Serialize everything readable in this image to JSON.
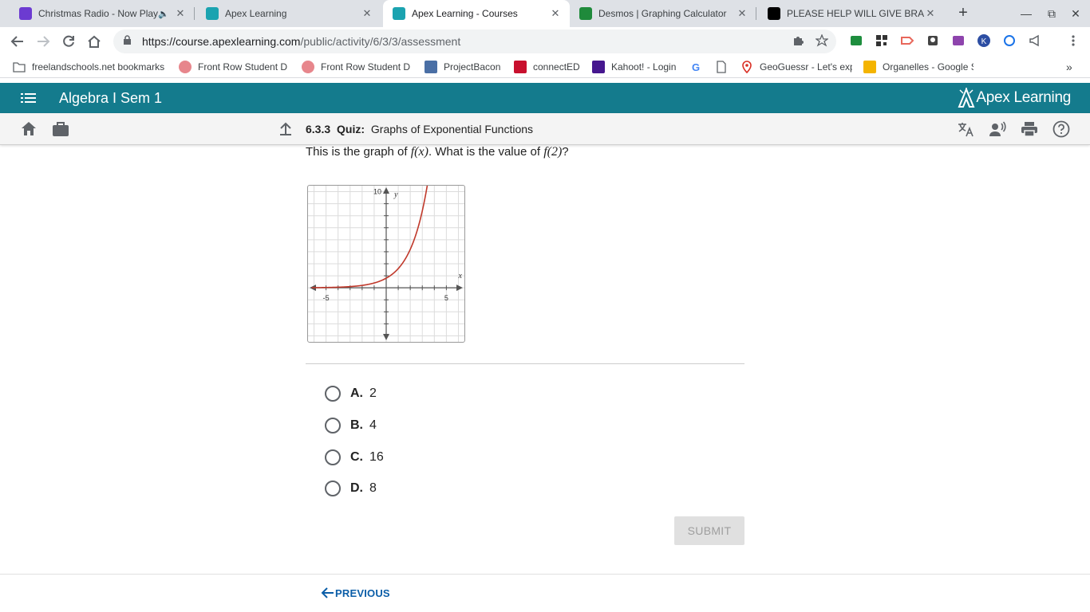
{
  "browser": {
    "tabs": [
      {
        "title": "Christmas Radio - Now Playing",
        "favicon_color": "#6c3bd1"
      },
      {
        "title": "Apex Learning",
        "favicon_color": "#1ba3b0"
      },
      {
        "title": "Apex Learning - Courses",
        "favicon_color": "#1ba3b0"
      },
      {
        "title": "Desmos | Graphing Calculator",
        "favicon_color": "#1f8a3b"
      },
      {
        "title": "PLEASE HELP WILL GIVE BRAINLIEST",
        "favicon_color": "#000000"
      }
    ],
    "url_host": "https://course.apexlearning.com",
    "url_path": "/public/activity/6/3/3/assessment",
    "bookmarks": [
      "freelandschools.net bookmarks",
      "Front Row Student D",
      "Front Row Student D",
      "ProjectBacon",
      "connectED",
      "Kahoot! - Login",
      "GeoGuessr - Let's exp",
      "Organelles - Google S"
    ]
  },
  "app": {
    "course_title": "Algebra I Sem 1",
    "brand": "Apex Learning",
    "header_color": "#147b8d"
  },
  "activity": {
    "number": "6.3.3",
    "type": "Quiz:",
    "title": "Graphs of Exponential Functions"
  },
  "question": {
    "text_before": "This is the graph of ",
    "fx": "f(x)",
    "text_mid": ". What is the value of ",
    "f2": "f(2)",
    "text_after": "?"
  },
  "graph": {
    "x_label": "x",
    "y_label": "y",
    "x_tick_neg": "-5",
    "x_tick_pos": "5",
    "y_tick": "10",
    "curve_color": "#c0392b"
  },
  "chart_data": {
    "type": "line",
    "function_points": [
      {
        "x": -6,
        "y": 0.016
      },
      {
        "x": -4,
        "y": 0.0625
      },
      {
        "x": -2,
        "y": 0.25
      },
      {
        "x": -1,
        "y": 0.5
      },
      {
        "x": 0,
        "y": 1
      },
      {
        "x": 1,
        "y": 2
      },
      {
        "x": 2,
        "y": 4
      },
      {
        "x": 3,
        "y": 8
      },
      {
        "x": 3.4,
        "y": 10.6
      }
    ],
    "xlim": [
      -6.5,
      6.5
    ],
    "ylim": [
      -4.5,
      8.5
    ],
    "x_ticks": [
      "-5",
      "5"
    ],
    "y_ticks": [
      "10"
    ],
    "xlabel": "x",
    "ylabel": "y",
    "grid": true
  },
  "choices": [
    {
      "letter": "A.",
      "value": "2"
    },
    {
      "letter": "B.",
      "value": "4"
    },
    {
      "letter": "C.",
      "value": "16"
    },
    {
      "letter": "D.",
      "value": "8"
    }
  ],
  "buttons": {
    "submit": "SUBMIT",
    "previous": "PREVIOUS"
  }
}
